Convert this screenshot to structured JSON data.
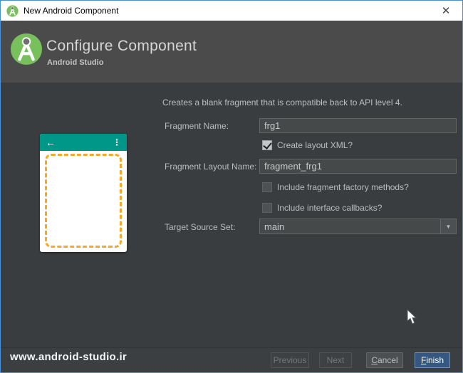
{
  "window": {
    "title": "New Android Component"
  },
  "header": {
    "title": "Configure Component",
    "subtitle": "Android Studio"
  },
  "form": {
    "description": "Creates a blank fragment that is compatible back to API level 4.",
    "fragment_name": {
      "label": "Fragment Name:",
      "value": "frg1"
    },
    "create_layout_xml": {
      "label": "Create layout XML?",
      "checked": true
    },
    "fragment_layout_name": {
      "label": "Fragment Layout Name:",
      "value": "fragment_frg1"
    },
    "include_factory_methods": {
      "label": "Include fragment factory methods?",
      "checked": false
    },
    "include_interface_callbacks": {
      "label": "Include interface callbacks?",
      "checked": false
    },
    "target_source_set": {
      "label": "Target Source Set:",
      "value": "main"
    }
  },
  "icons": {
    "close": "✕",
    "back": "←",
    "overflow": "⋮",
    "dropdown": "▼"
  },
  "preview": {
    "appbar_color": "#009688",
    "fragment_outline_color": "#f9a825"
  },
  "footer": {
    "watermark": "www.android-studio.ir",
    "buttons": {
      "previous": {
        "label": "Previous",
        "enabled": false
      },
      "next": {
        "label": "Next",
        "enabled": false
      },
      "cancel": {
        "label": "Cancel",
        "enabled": true
      },
      "finish": {
        "label": "Finish",
        "enabled": true,
        "default": true
      }
    }
  },
  "colors": {
    "window_border": "#4a90d9",
    "titlebar_bg": "#ffffff",
    "header_bg": "#4b4b4b",
    "content_bg": "#3a3d3f",
    "field_bg": "#45494a",
    "field_border": "#646464",
    "finish_button_bg": "#365880",
    "logo_green": "#77c05c"
  }
}
